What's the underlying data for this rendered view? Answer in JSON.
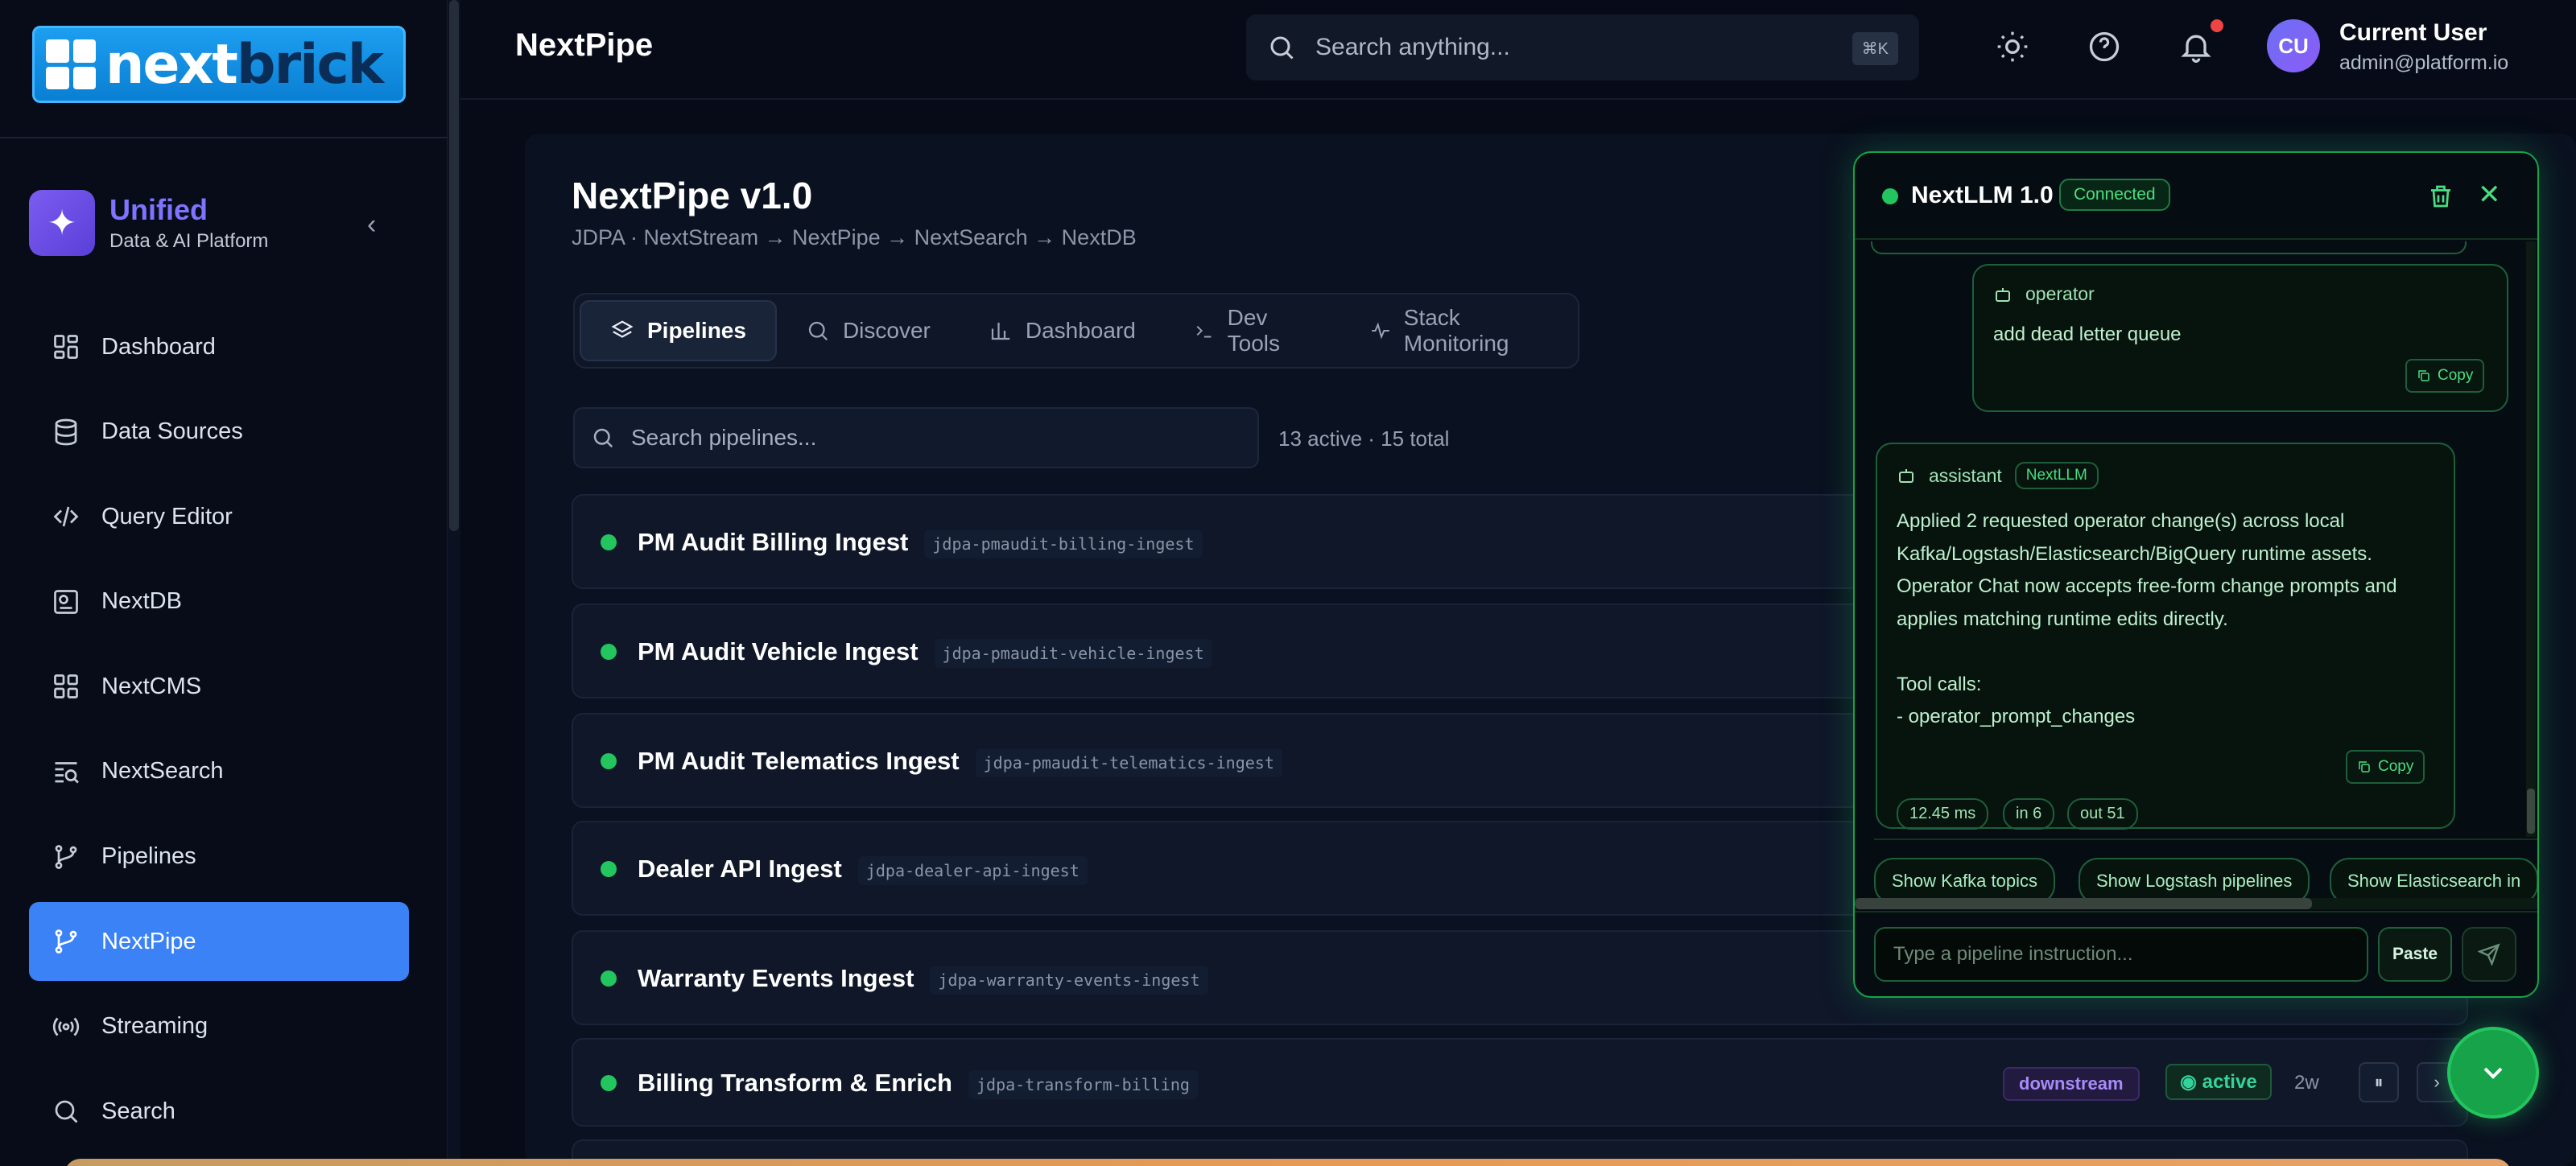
{
  "logo": {
    "text_a": "next",
    "text_b": "brick"
  },
  "brand": {
    "title": "Unified",
    "subtitle": "Data & AI Platform",
    "collapse_glyph": "‹"
  },
  "sidebar": {
    "items": [
      {
        "label": "Dashboard",
        "icon": "dashboard-icon"
      },
      {
        "label": "Data Sources",
        "icon": "database-icon"
      },
      {
        "label": "Query Editor",
        "icon": "code-icon"
      },
      {
        "label": "NextDB",
        "icon": "db-box-icon"
      },
      {
        "label": "NextCMS",
        "icon": "grid-icon"
      },
      {
        "label": "NextSearch",
        "icon": "search-list-icon"
      },
      {
        "label": "Pipelines",
        "icon": "branch-icon"
      },
      {
        "label": "NextPipe",
        "icon": "branch-icon",
        "active": true
      },
      {
        "label": "Streaming",
        "icon": "broadcast-icon"
      },
      {
        "label": "Search",
        "icon": "search-icon"
      }
    ]
  },
  "header": {
    "title": "NextPipe",
    "search_placeholder": "Search anything...",
    "shortcut": "⌘K",
    "user": {
      "initials": "CU",
      "name": "Current User",
      "email": "admin@platform.io"
    }
  },
  "page": {
    "title": "NextPipe v1.0",
    "breadcrumb": "JDPA · NextStream → NextPipe → NextSearch → NextDB",
    "tabs": [
      {
        "label": "Pipelines",
        "icon": "layers-icon",
        "active": true
      },
      {
        "label": "Discover",
        "icon": "search-icon"
      },
      {
        "label": "Dashboard",
        "icon": "bar-chart-icon"
      },
      {
        "label": "Dev Tools",
        "icon": "terminal-icon"
      },
      {
        "label": "Stack Monitoring",
        "icon": "activity-icon"
      }
    ],
    "pipeline_search_placeholder": "Search pipelines...",
    "count_text": "13 active · 15 total"
  },
  "pipelines": [
    {
      "name": "PM Audit Billing Ingest",
      "slug": "jdpa-pmaudit-billing-ingest"
    },
    {
      "name": "PM Audit Vehicle Ingest",
      "slug": "jdpa-pmaudit-vehicle-ingest"
    },
    {
      "name": "PM Audit Telematics Ingest",
      "slug": "jdpa-pmaudit-telematics-ingest"
    },
    {
      "name": "Dealer API Ingest",
      "slug": "jdpa-dealer-api-ingest"
    },
    {
      "name": "Warranty Events Ingest",
      "slug": "jdpa-warranty-events-ingest"
    },
    {
      "name": "Billing Transform & Enrich",
      "slug": "jdpa-transform-billing",
      "badge": "downstream",
      "status": "active",
      "age": "2w",
      "pause_glyph": "⏸",
      "open_glyph": "›"
    }
  ],
  "chat": {
    "title": "NextLLM 1.0",
    "status": "Connected",
    "close_glyph": "✕",
    "operator": {
      "role": "operator",
      "text": "add dead letter queue",
      "copy": "Copy"
    },
    "assistant": {
      "role": "assistant",
      "tag": "NextLLM",
      "text": "Applied 2 requested operator change(s) across local Kafka/Logstash/Elasticsearch/BigQuery runtime assets. Operator Chat now accepts free-form change prompts and applies matching runtime edits directly.\n\nTool calls:\n- operator_prompt_changes",
      "copy": "Copy",
      "metrics": [
        "12.45 ms",
        "in 6",
        "out 51"
      ]
    },
    "suggestions": [
      "Show Kafka topics",
      "Show Logstash pipelines",
      "Show Elasticsearch in"
    ],
    "input_placeholder": "Type a pipeline instruction...",
    "paste_label": "Paste"
  },
  "colors": {
    "accent": "#3b82f6",
    "chat_green": "#22c55e",
    "brand_purple": "#7f73ff"
  }
}
